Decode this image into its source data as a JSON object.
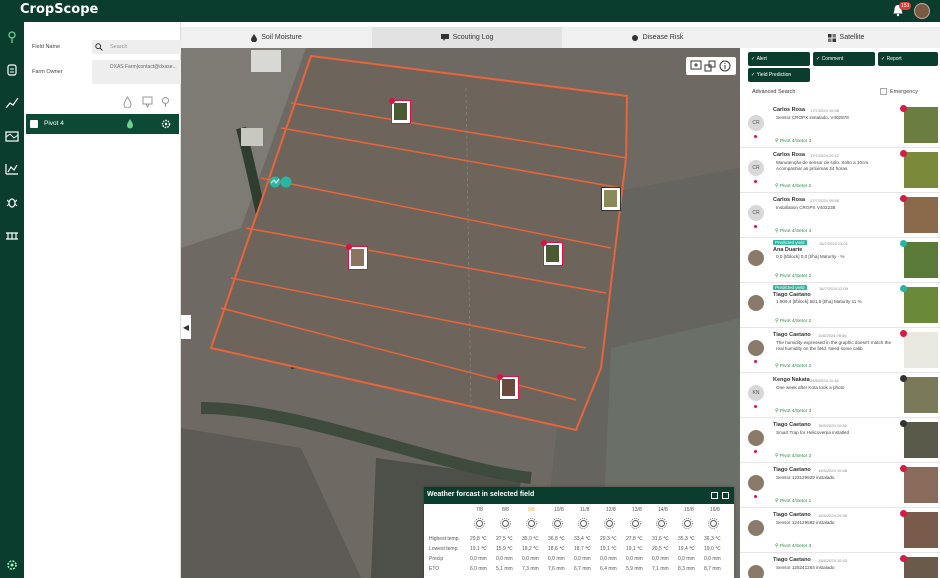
{
  "app": {
    "title": "CropScope",
    "notification_count": "153"
  },
  "sidebar": {
    "field_name_label": "Field Name",
    "search_placeholder": "Search",
    "farm_owner_label": "Farm Owner",
    "farm_owner_value": "DXAS Farm|contact@dxase...",
    "pivot": {
      "name": "Pivot 4"
    }
  },
  "tabs": [
    {
      "label": "Soil Moisture"
    },
    {
      "label": "Scouting Log"
    },
    {
      "label": "Disease Risk"
    },
    {
      "label": "Satellite"
    }
  ],
  "filters": [
    {
      "label": "Alert"
    },
    {
      "label": "Comment"
    },
    {
      "label": "Report"
    },
    {
      "label": "Yield Prediction"
    }
  ],
  "advanced_search": "Advanced Search",
  "emergency_label": "Emergency",
  "feed": [
    {
      "name": "Carlos Rosa",
      "date": "17/7/2024 10:36",
      "initials": "CR",
      "text": "Sensor CROPX instalado. V402878",
      "location": "Pivot 4/Setor 3"
    },
    {
      "name": "Carlos Rosa",
      "date": "17/7/2024 10:12",
      "initials": "CR",
      "text": "Manutenção de sensor de solo. Solto a 10cm. Acompanhar as próximas 24 horas.",
      "location": "Pivot 4/Setor 2"
    },
    {
      "name": "Carlos Rosa",
      "date": "17/7/2024 09:56",
      "initials": "CR",
      "text": "Installation CROPX V402238",
      "location": "Pivot 4/Setor 4"
    },
    {
      "tag": "Predicted yield",
      "name": "Ana Duarte",
      "date": "16/7/2024 13:01",
      "text": "0,0 [t/block] 0,0 [t/ha]  Maturity  - %",
      "location": "Pivot 4/Setor 2"
    },
    {
      "tag": "Predicted yield",
      "name": "Tiago Caetano",
      "date": "16/7/2024 12:09",
      "text": "1.909,4 [t/block] 561,6 [t/ha]  Maturity  11 %",
      "location": "Pivot 4/Setor 2"
    },
    {
      "name": "Tiago Caetano",
      "date": "11/6/2024 09:56",
      "text": "The humidity expressed in the graphic doesn't match the real humidity on the field. Need some calib",
      "location": "Pivot 4/Setor 2"
    },
    {
      "name": "Kengo Nakata",
      "date": "24/5/2024 11:16",
      "initials": "KN",
      "text": "One week after Kota took a photo",
      "location": "Pivot 4/Setor 3"
    },
    {
      "name": "Tiago Caetano",
      "date": "15/5/2024 10:32",
      "text": "Smart Trap for Helicoverpa installed",
      "location": "Pivot 4/Setor 2"
    },
    {
      "name": "Tiago Caetano",
      "date": "15/4/2024 10:48",
      "text": "Sensor 123129929 instalado",
      "location": "Pivot 4/Setor 1"
    },
    {
      "name": "Tiago Caetano",
      "date": "15/4/2024 10:35",
      "text": "Sensor 124129592 instalado",
      "location": "Pivot 4/Setor 3"
    },
    {
      "name": "Tiago Caetano",
      "date": "15/4/2024 10:33",
      "text": "Sensor 125241264 instalado",
      "location": ""
    }
  ],
  "weather": {
    "title": "Weather forcast in selected field",
    "days": [
      "7/8",
      "8/8",
      "9/8",
      "10/8",
      "11/8",
      "12/8",
      "13/8",
      "14/8",
      "15/8",
      "16/8"
    ],
    "highest_label": "Highest temp.",
    "highest": [
      "29,8 ℃",
      "27,5 ℃",
      "35,0 ℃",
      "36,8 ℃",
      "33,4 ℃",
      "29,3 ℃",
      "27,8 ℃",
      "31,6 ℃",
      "35,3 ℃",
      "36,3 ℃"
    ],
    "lowest_label": "Lowest temp.",
    "lowest": [
      "19,1 ℃",
      "15,9 ℃",
      "18,2 ℃",
      "18,6 ℃",
      "18,7 ℃",
      "19,1 ℃",
      "19,1 ℃",
      "20,5 ℃",
      "19,4 ℃",
      "19,0 ℃"
    ],
    "precip_label": "Precip",
    "precip": [
      "0,0 mm",
      "0,0 mm",
      "0,0 mm",
      "0,0 mm",
      "0,0 mm",
      "0,0 mm",
      "0,0 mm",
      "0,0 mm",
      "0,0 mm",
      "0,0 mm"
    ],
    "eto_label": "ETO",
    "eto": [
      "6,0 mm",
      "5,1 mm",
      "7,3 mm",
      "7,6 mm",
      "6,7 mm",
      "6,4 mm",
      "5,9 mm",
      "7,1 mm",
      "8,3 mm",
      "8,7 mm"
    ]
  },
  "colors": {
    "brand": "#0b3d2e",
    "field_outline": "#e8643a",
    "pin": "#d11e44",
    "teal": "#2bb5a0"
  }
}
